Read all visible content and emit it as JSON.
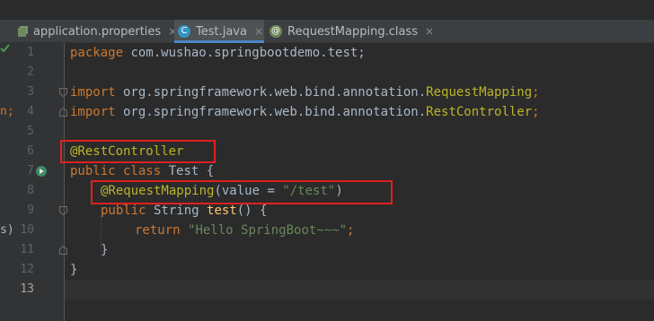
{
  "tabs": [
    {
      "label": "application.properties",
      "active": false
    },
    {
      "label": "Test.java",
      "active": true
    },
    {
      "label": "RequestMapping.class",
      "active": false
    }
  ],
  "close_glyph": "×",
  "line_numbers": [
    "1",
    "2",
    "3",
    "4",
    "5",
    "6",
    "7",
    "8",
    "9",
    "10",
    "11",
    "12",
    "13"
  ],
  "gutter_edge_chars": {
    "line4": "n;",
    "line10": "s)"
  },
  "code": {
    "line1_kw": "package",
    "line1_rest": " com.wushao.springbootdemo.test;",
    "line3_kw": "import",
    "line3_pkg": " org.springframework.web.bind.annotation.",
    "line3_cls": "RequestMapping",
    "line3_end": ";",
    "line4_kw": "import",
    "line4_pkg": " org.springframework.web.bind.annotation.",
    "line4_cls": "RestController",
    "line4_end": ";",
    "line6_ann": "@RestController",
    "line7_kw": "public class",
    "line7_rest": " Test {",
    "line8_ann": "@RequestMapping",
    "line8_open": "(value = ",
    "line8_str": "\"/test\"",
    "line8_close": ")",
    "line9_kw": "public",
    "line9_type": " String ",
    "line9_fn": "test",
    "line9_rest": "() {",
    "line10_kw": "return",
    "line10_str": "\"Hello SpringBoot~~~\"",
    "line10_end": ";",
    "line11": "}",
    "line12": "}"
  },
  "colors": {
    "editor_bg": "#2b2b2b",
    "keyword": "#cc7832",
    "annotation": "#bbb529",
    "string": "#6a8759",
    "method": "#ffc66d",
    "highlight_box": "#e02020",
    "active_tab_underline": "#4a88c7"
  },
  "icons": [
    "properties-file-icon",
    "java-class-icon",
    "annotation-class-icon",
    "run-class-icon",
    "checkmark-icon",
    "fold-marker-icon"
  ]
}
